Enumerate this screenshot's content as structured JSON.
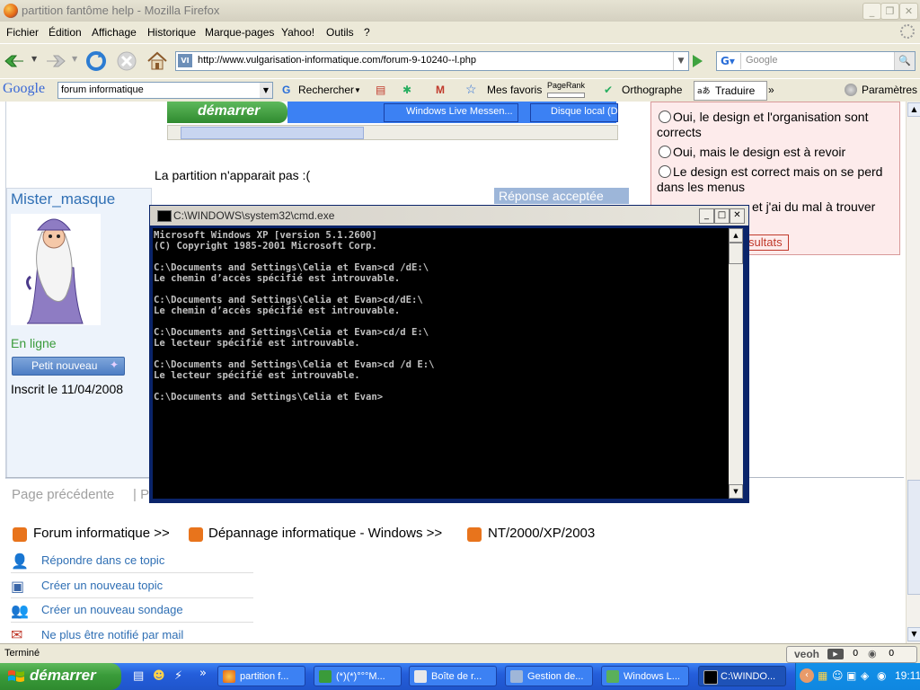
{
  "firefox": {
    "title": "partition fantôme help - Mozilla Firefox",
    "menu": [
      "Fichier",
      "Édition",
      "Affichage",
      "Historique",
      "Marque-pages",
      "Yahoo!",
      "Outils",
      "?"
    ],
    "url": "http://www.vulgarisation-informatique.com/forum-9-10240--l.php",
    "search_placeholder": "Google",
    "status": "Terminé"
  },
  "google_toolbar": {
    "logo": "Google",
    "query": "forum informatique",
    "search_label": "Rechercher",
    "favorites_label": "Mes favoris",
    "pagerank_label": "PageRank",
    "spell_label": "Orthographe",
    "translate_label": "Traduire",
    "settings_label": "Paramètres"
  },
  "page": {
    "embedded_screenshot": {
      "start_label": "démarrer",
      "task1": "Windows Live Messen...",
      "task2": "Disque local (D:"
    },
    "post_text": "La partition  n'apparait pas :(",
    "poll_options": [
      "Oui, le design et l'organisation sont corrects",
      "Oui, mais le design est à revoir",
      "Le design est correct mais on se perd dans les menus",
      "et j'ai du mal à trouver"
    ],
    "poll_results_label": "sultats",
    "author": {
      "name": "Mister_masque",
      "status": "En ligne",
      "rank": "Petit nouveau",
      "registered": "Inscrit le 11/04/2008"
    },
    "accepted_label": "Réponse acceptée",
    "pagination_prev": "Page précédente",
    "pagination_sep": "| P",
    "breadcrumb": [
      "Forum informatique >>",
      "Dépannage informatique - Windows >>",
      "NT/2000/XP/2003"
    ],
    "actions": [
      "Répondre dans ce topic",
      "Créer un nouveau topic",
      "Créer un nouveau sondage",
      "Ne plus être notifié par mail"
    ]
  },
  "cmd": {
    "title": "C:\\WINDOWS\\system32\\cmd.exe",
    "output": "Microsoft Windows XP [version 5.1.2600]\n(C) Copyright 1985-2001 Microsoft Corp.\n\nC:\\Documents and Settings\\Celia et Evan>cd /dE:\\\nLe chemin d’accès spécifié est introuvable.\n\nC:\\Documents and Settings\\Celia et Evan>cd/dE:\\\nLe chemin d’accès spécifié est introuvable.\n\nC:\\Documents and Settings\\Celia et Evan>cd/d E:\\\nLe lecteur spécifié est introuvable.\n\nC:\\Documents and Settings\\Celia et Evan>cd /d E:\\\nLe lecteur spécifié est introuvable.\n\nC:\\Documents and Settings\\Celia et Evan>"
  },
  "taskbar": {
    "start_label": "démarrer",
    "tasks": [
      "partition f...",
      "(*)(*)°°°M...",
      "Boîte de r...",
      "Gestion de...",
      "Windows L...",
      "C:\\WINDO..."
    ],
    "clock": "19:11"
  },
  "veoh": {
    "logo": "veoh",
    "count1": "0",
    "count2": "0"
  }
}
